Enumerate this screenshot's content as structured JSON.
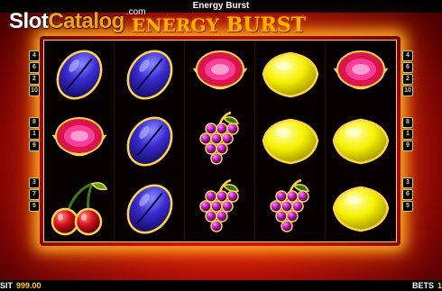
{
  "window": {
    "title": "Energy Burst"
  },
  "watermark": {
    "part1": "Slot",
    "part2": "Catalog",
    "suffix": ".com"
  },
  "logo": {
    "word1": "ENERGY",
    "word2": "BURST"
  },
  "reels": [
    [
      "plum",
      "watermelon",
      "cherries"
    ],
    [
      "plum",
      "plum",
      "plum"
    ],
    [
      "watermelon",
      "grapes",
      "grapes"
    ],
    [
      "lemon",
      "lemon",
      "grapes"
    ],
    [
      "watermelon",
      "lemon",
      "lemon"
    ]
  ],
  "paylines": {
    "left": [
      [
        "4",
        "6",
        "2",
        "10"
      ],
      [
        "8",
        "1",
        "9"
      ],
      [
        "3",
        "7",
        "5"
      ]
    ],
    "right": [
      [
        "4",
        "6",
        "2",
        "10"
      ],
      [
        "8",
        "1",
        "9"
      ],
      [
        "3",
        "6",
        "5"
      ]
    ]
  },
  "footer": {
    "credit_label": "SIT",
    "credit_value": "999.00",
    "bets_label": "BETS",
    "bets_value": "1"
  },
  "colors": {
    "background": "#d0140a",
    "frame_glow": "#ffbe28",
    "logo_gold": "#ffb300",
    "reel_background": "#070000"
  }
}
